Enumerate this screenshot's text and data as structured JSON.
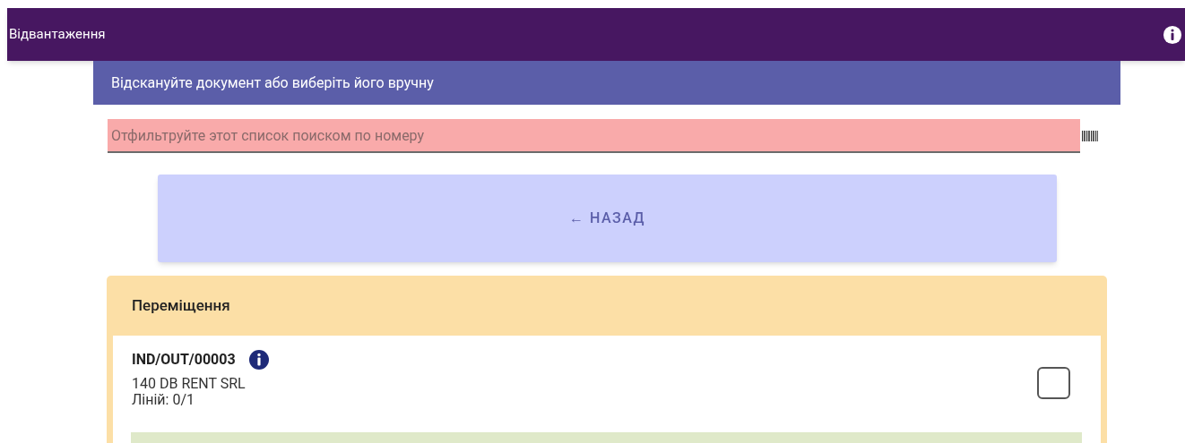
{
  "app_bar": {
    "title": "Відвантаження"
  },
  "banner": {
    "text": "Відскануйте документ або виберіть його вручну"
  },
  "search": {
    "placeholder": "Отфильтруйте этот список поиском по номеру"
  },
  "back_button": {
    "label": "← НАЗАД"
  },
  "group": {
    "title": "Переміщення",
    "items": [
      {
        "number": "IND/OUT/00003",
        "partner": "140 DB RENT SRL",
        "lines": "Ліній: 0/1",
        "checked": false
      }
    ]
  }
}
